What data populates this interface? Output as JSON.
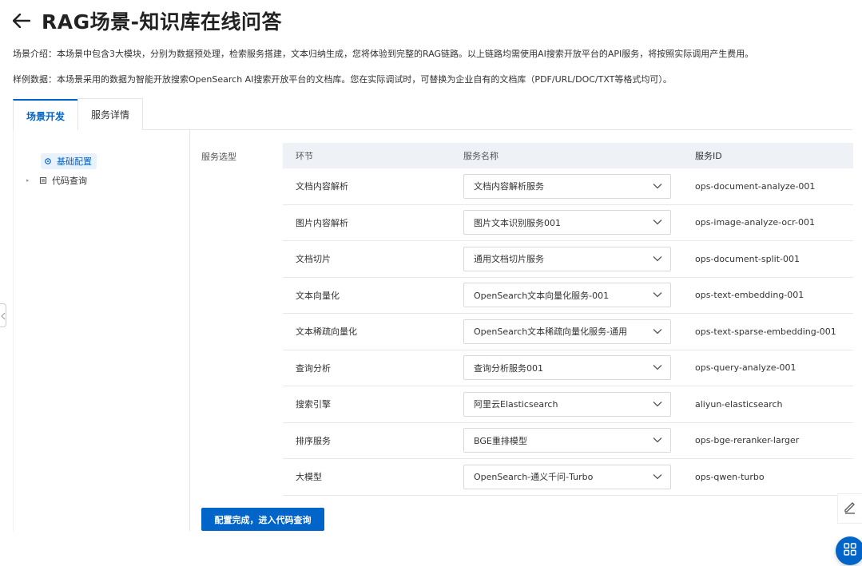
{
  "header": {
    "title": "RAG场景-知识库在线问答"
  },
  "intro": {
    "line1": "场景介绍：本场景中包含3大模块，分别为数据预处理，检索服务搭建，文本归纳生成，您将体验到完整的RAG链路。以上链路均需使用AI搜索开放平台的API服务，将按照实际调用产生费用。",
    "line2": "样例数据：本场景采用的数据为智能开放搜索OpenSearch AI搜索开放平台的文档库。您在实际调试时，可替换为企业自有的文档库（PDF/URL/DOC/TXT等格式均可）。"
  },
  "tabs": [
    {
      "label": "场景开发"
    },
    {
      "label": "服务详情"
    }
  ],
  "sidebar": {
    "items": [
      {
        "label": "基础配置"
      },
      {
        "label": "代码查询"
      }
    ]
  },
  "service_label": "服务选型",
  "table": {
    "headers": [
      "环节",
      "服务名称",
      "服务ID"
    ],
    "rows": [
      {
        "stage": "文档内容解析",
        "service": "文档内容解析服务",
        "id": "ops-document-analyze-001"
      },
      {
        "stage": "图片内容解析",
        "service": "图片文本识别服务001",
        "id": "ops-image-analyze-ocr-001"
      },
      {
        "stage": "文档切片",
        "service": "通用文档切片服务",
        "id": "ops-document-split-001"
      },
      {
        "stage": "文本向量化",
        "service": "OpenSearch文本向量化服务-001",
        "id": "ops-text-embedding-001"
      },
      {
        "stage": "文本稀疏向量化",
        "service": "OpenSearch文本稀疏向量化服务-通用",
        "id": "ops-text-sparse-embedding-001"
      },
      {
        "stage": "查询分析",
        "service": "查询分析服务001",
        "id": "ops-query-analyze-001"
      },
      {
        "stage": "搜索引擎",
        "service": "阿里云Elasticsearch",
        "id": "aliyun-elasticsearch"
      },
      {
        "stage": "排序服务",
        "service": "BGE重排模型",
        "id": "ops-bge-reranker-larger"
      },
      {
        "stage": "大模型",
        "service": "OpenSearch-通义千问-Turbo",
        "id": "ops-qwen-turbo"
      }
    ]
  },
  "primary_button": "配置完成，进入代码查询",
  "colors": {
    "accent": "#0064c8",
    "header_bg": "#eef2f6"
  }
}
